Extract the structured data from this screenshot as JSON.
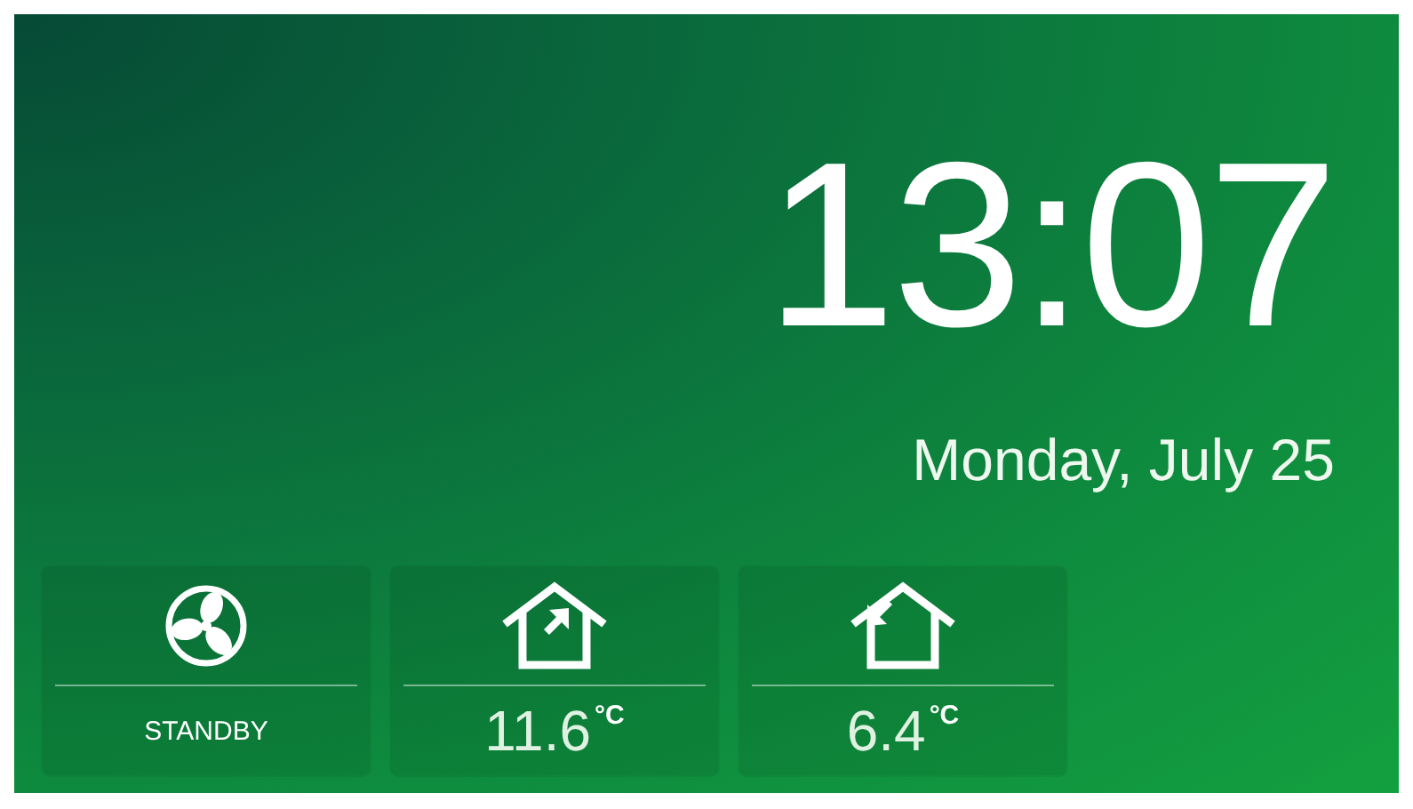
{
  "clock": {
    "time": "13:07",
    "date": "Monday, July 25"
  },
  "tiles": [
    {
      "kind": "fan",
      "label": "STANDBY"
    },
    {
      "kind": "indoor",
      "value": "11.6",
      "unit": "°C"
    },
    {
      "kind": "outdoor",
      "value": "6.4",
      "unit": "°C"
    }
  ]
}
